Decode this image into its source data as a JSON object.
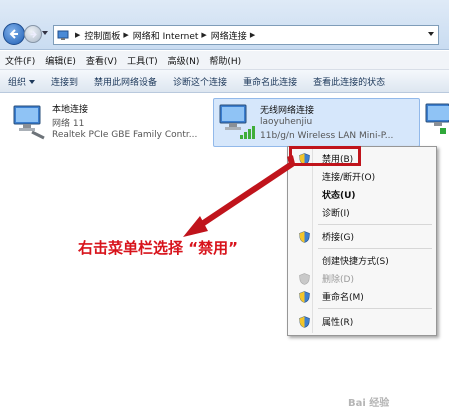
{
  "address_bar": {
    "breadcrumbs": [
      "控制面板",
      "网络和 Internet",
      "网络连接"
    ]
  },
  "menu": [
    "文件(F)",
    "编辑(E)",
    "查看(V)",
    "工具(T)",
    "高级(N)",
    "帮助(H)"
  ],
  "toolbar": {
    "organize": "组织",
    "items": [
      "连接到",
      "禁用此网络设备",
      "诊断这个连接",
      "重命名此连接",
      "查看此连接的状态"
    ]
  },
  "connections": [
    {
      "name": "本地连接",
      "line2": "网络  11",
      "line3": "Realtek PCIe GBE Family Contr..."
    },
    {
      "name": "无线网络连接",
      "line2": "laoyuhenjiu",
      "line3": "11b/g/n  Wireless LAN Mini-P..."
    }
  ],
  "context_menu": {
    "items": [
      {
        "label": "禁用(B)",
        "icon": "shield-icon"
      },
      {
        "label": "连接/断开(O)"
      },
      {
        "label": "状态(U)",
        "bold": true
      },
      {
        "label": "诊断(I)"
      },
      {
        "label": "桥接(G)",
        "icon": "shield-icon"
      },
      {
        "label": "创建快捷方式(S)"
      },
      {
        "label": "删除(D)",
        "icon": "shield-icon",
        "disabled": true
      },
      {
        "label": "重命名(M)",
        "icon": "shield-icon"
      },
      {
        "label": "属性(R)",
        "icon": "shield-icon"
      }
    ]
  },
  "annotation": {
    "text": "右击菜单栏选择 “禁用”"
  },
  "watermark": "Bai 经验",
  "colors": {
    "highlight_red": "#c0141c",
    "annotation_red": "#d8131b",
    "selection_blue": "#d6e7fb"
  }
}
